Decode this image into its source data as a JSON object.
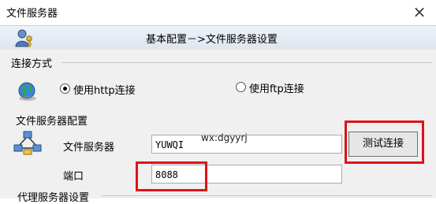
{
  "window": {
    "title": "文件服务器",
    "close_glyph": "×"
  },
  "header": {
    "title": "基本配置－>文件服务器设置",
    "icon": "user-key-icon"
  },
  "connection": {
    "section_label": "连接方式",
    "icon": "globe-icon",
    "http_label": "使用http连接",
    "http_selected": true,
    "ftp_label": "使用ftp连接",
    "ftp_selected": false
  },
  "file_server": {
    "section_label": "文件服务器配置",
    "icon": "network-icon",
    "server_label": "文件服务器",
    "server_value": "YUWQI",
    "port_label": "端口",
    "port_value": "8088",
    "test_button": "测试连接"
  },
  "proxy": {
    "section_label": "代理服务器设置"
  },
  "watermark": "wx:dgyyrj",
  "colors": {
    "highlight": "#e0101a",
    "header_bg": "#e6ebf2",
    "panel_bg": "#f0f0f0"
  }
}
